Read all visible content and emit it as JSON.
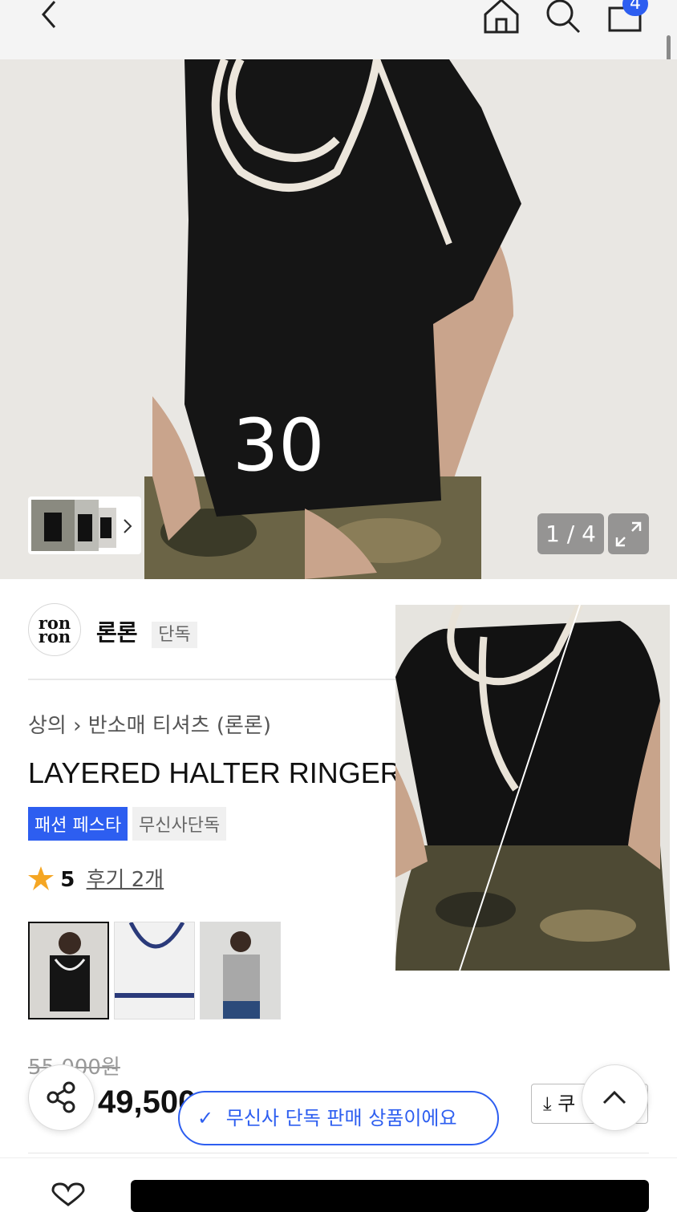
{
  "topbar": {
    "cart_count": "4",
    "icons": [
      "back-icon",
      "home-icon",
      "search-icon",
      "shopping-bag-icon"
    ]
  },
  "hero": {
    "counter": "1 / 4",
    "overlay_text": "30"
  },
  "brand": {
    "logo_text_1": "ron",
    "logo_text_2": "ron",
    "name": "론론",
    "badge": "단독"
  },
  "breadcrumb": {
    "category": "상의",
    "sub": "반소매 티셔츠 (론론)"
  },
  "product": {
    "title": "LAYERED HALTER RINGER",
    "tags": [
      "패션 페스타",
      "무신사단독"
    ],
    "rating": "5",
    "reviews": "후기 2개",
    "original_price": "55,000원",
    "price": "49,500"
  },
  "toast": {
    "text": "무신사 단독 판매 상품이에요"
  },
  "coupon": {
    "label": "쿠"
  },
  "colors": {
    "accent": "#2d5ef0",
    "star": "#f5a623"
  }
}
